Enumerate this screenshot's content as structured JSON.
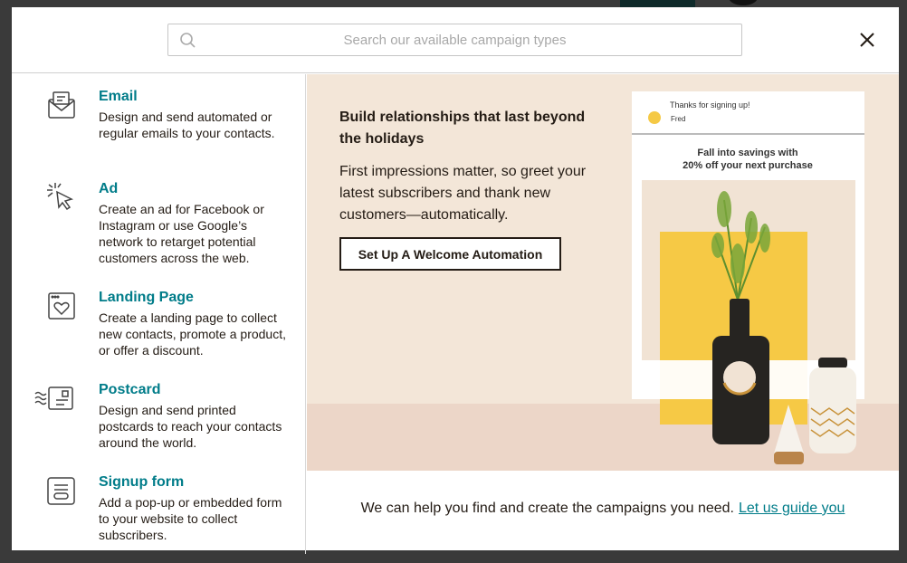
{
  "search": {
    "placeholder": "Search our available campaign types"
  },
  "campaign_types": [
    {
      "title": "Email",
      "description": "Design and send automated or regular emails to your contacts.",
      "icon": "envelope-icon"
    },
    {
      "title": "Ad",
      "description": "Create an ad for Facebook or Instagram or use Google’s network to retarget potential customers across the web.",
      "icon": "cursor-click-icon"
    },
    {
      "title": "Landing Page",
      "description": "Create a landing page to collect new contacts, promote a product, or offer a discount.",
      "icon": "heart-page-icon"
    },
    {
      "title": "Postcard",
      "description": "Design and send printed postcards to reach your contacts around the world.",
      "icon": "postcard-icon"
    },
    {
      "title": "Signup form",
      "description": "Add a pop-up or embedded form to your website to collect subscribers.",
      "icon": "form-icon"
    }
  ],
  "promo": {
    "heading": "Build relationships that last beyond the holidays",
    "body": "First impressions matter, so greet your latest subscribers and thank new customers—automatically.",
    "cta_label": "Set Up A Welcome Automation",
    "preview": {
      "subject": "Thanks for signing up!",
      "sender": "Fred",
      "headline_1": "Fall into savings with",
      "headline_2": "20% off your next purchase"
    }
  },
  "footer": {
    "text": "We can help you find and create the campaigns you need.",
    "link": "Let us guide you"
  },
  "colors": {
    "accent": "#007c89",
    "promo_bg": "#f3e6d8",
    "text": "#241c15"
  }
}
